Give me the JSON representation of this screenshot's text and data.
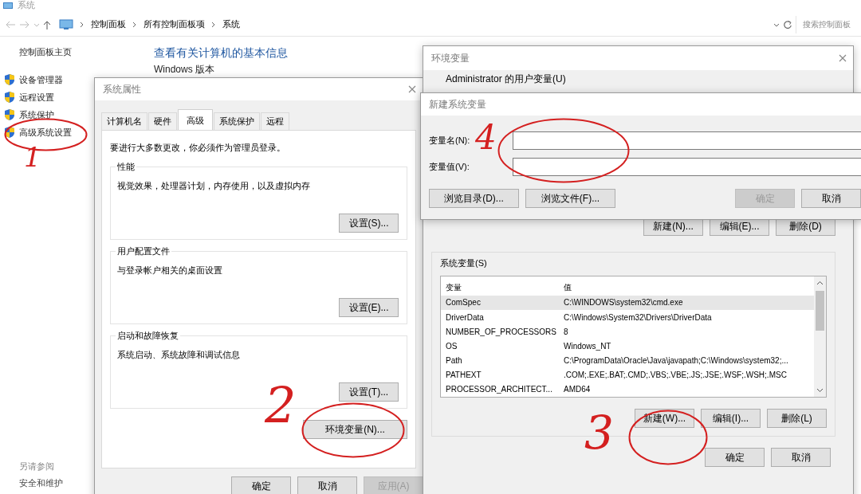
{
  "explorer": {
    "title": "系统",
    "breadcrumb": [
      "控制面板",
      "所有控制面板项",
      "系统"
    ],
    "search": {
      "placeholder": "搜索控制面板"
    },
    "sidebar": {
      "home": "控制面板主页",
      "links": [
        "设备管理器",
        "远程设置",
        "系统保护",
        "高级系统设置"
      ],
      "see_also": "另请参阅",
      "see_also_links": [
        "安全和维护"
      ]
    },
    "heading": "查看有关计算机的基本信息",
    "section": "Windows 版本"
  },
  "system_properties": {
    "title": "系统属性",
    "tabs": [
      {
        "label": "计算机名",
        "selected": false
      },
      {
        "label": "硬件",
        "selected": false
      },
      {
        "label": "高级",
        "selected": true
      },
      {
        "label": "系统保护",
        "selected": false
      },
      {
        "label": "远程",
        "selected": false
      }
    ],
    "notice": "要进行大多数更改，你必须作为管理员登录。",
    "groups": [
      {
        "title": "性能",
        "description": "视觉效果，处理器计划，内存使用，以及虚拟内存",
        "button": "设置(S)..."
      },
      {
        "title": "用户配置文件",
        "description": "与登录帐户相关的桌面设置",
        "button": "设置(E)..."
      },
      {
        "title": "启动和故障恢复",
        "description": "系统启动、系统故障和调试信息",
        "button": "设置(T)..."
      }
    ],
    "env_button": "环境变量(N)...",
    "buttons": [
      {
        "label": "确定",
        "disabled": false
      },
      {
        "label": "取消",
        "disabled": false
      },
      {
        "label": "应用(A)",
        "disabled": true
      }
    ]
  },
  "environment_variables": {
    "title": "环境变量",
    "user_section": "Administrator 的用户变量(U)",
    "user_buttons": [
      "新建(N)...",
      "编辑(E)...",
      "删除(D)"
    ],
    "system_section": "系统变量(S)",
    "columns": [
      "变量",
      "值"
    ],
    "rows": [
      {
        "name": "ComSpec",
        "value": "C:\\WINDOWS\\system32\\cmd.exe",
        "selected": true
      },
      {
        "name": "DriverData",
        "value": "C:\\Windows\\System32\\Drivers\\DriverData",
        "selected": false
      },
      {
        "name": "NUMBER_OF_PROCESSORS",
        "value": "8",
        "selected": false
      },
      {
        "name": "OS",
        "value": "Windows_NT",
        "selected": false
      },
      {
        "name": "Path",
        "value": "C:\\ProgramData\\Oracle\\Java\\javapath;C:\\Windows\\system32;...",
        "selected": false
      },
      {
        "name": "PATHEXT",
        "value": ".COM;.EXE;.BAT;.CMD;.VBS;.VBE;.JS;.JSE;.WSF;.WSH;.MSC",
        "selected": false
      },
      {
        "name": "PROCESSOR_ARCHITECT...",
        "value": "AMD64",
        "selected": false
      }
    ],
    "system_buttons": [
      "新建(W)...",
      "编辑(I)...",
      "删除(L)"
    ],
    "buttons": [
      "确定",
      "取消"
    ]
  },
  "new_system_variable": {
    "title": "新建系统变量",
    "fields": [
      {
        "label": "变量名(N):"
      },
      {
        "label": "变量值(V):"
      }
    ],
    "buttons": [
      {
        "label": "浏览目录(D)...",
        "disabled": false
      },
      {
        "label": "浏览文件(F)...",
        "disabled": false
      },
      {
        "label": "确定",
        "disabled": true
      },
      {
        "label": "取消",
        "disabled": false
      }
    ]
  },
  "annotations": [
    {
      "label": "1"
    },
    {
      "label": "2"
    },
    {
      "label": "3"
    },
    {
      "label": "4"
    }
  ]
}
